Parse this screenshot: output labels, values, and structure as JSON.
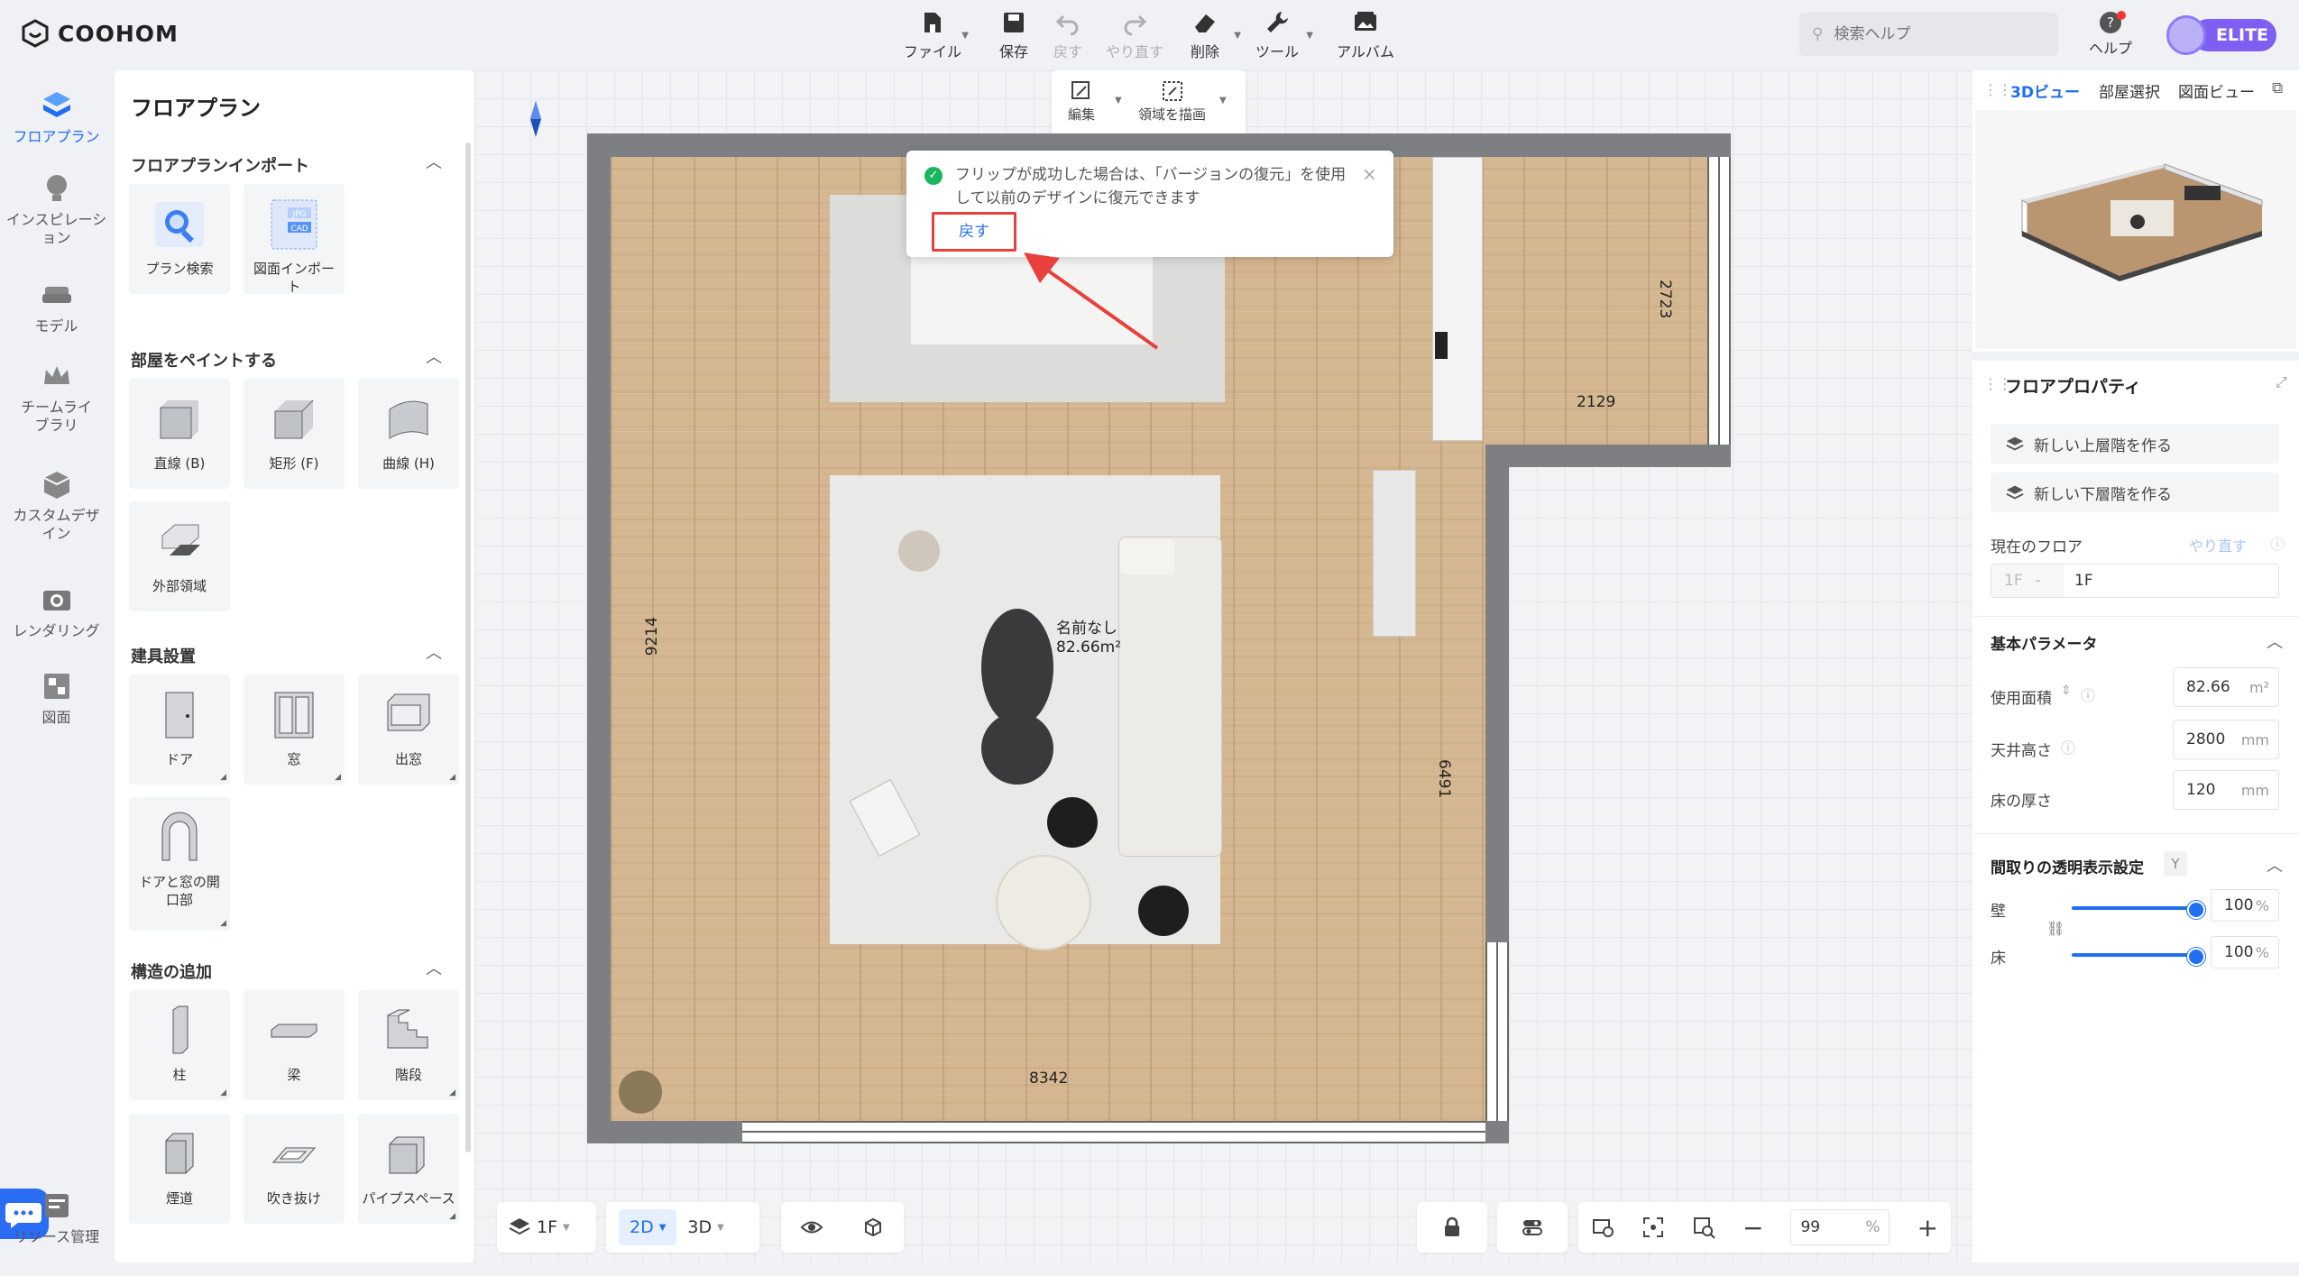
{
  "app": {
    "logo_text": "COOHOM"
  },
  "toolbar": {
    "file": "ファイル",
    "save": "保存",
    "undo": "戻す",
    "redo": "やり直す",
    "delete": "削除",
    "tools": "ツール",
    "album": "アルバム"
  },
  "search": {
    "placeholder": "検索ヘルプ"
  },
  "help": {
    "label": "ヘルプ"
  },
  "account": {
    "badge": "ELITE"
  },
  "leftnav": {
    "items": [
      {
        "label": "フロアプラン",
        "icon": "floorplan-icon"
      },
      {
        "label": "インスピレーション",
        "icon": "lightbulb-icon"
      },
      {
        "label": "モデル",
        "icon": "sofa-icon"
      },
      {
        "label": "チームライブラリ",
        "icon": "crown-icon"
      },
      {
        "label": "カスタムデザイン",
        "icon": "box-icon"
      },
      {
        "label": "レンダリング",
        "icon": "camera-icon"
      },
      {
        "label": "図面",
        "icon": "drawing-icon"
      },
      {
        "label": "リソース管理",
        "icon": "resource-icon"
      }
    ]
  },
  "panel": {
    "title": "フロアプラン",
    "sections": {
      "import": {
        "title": "フロアプランインポート",
        "items": [
          "プラン検索",
          "図面インポート"
        ]
      },
      "paint": {
        "title": "部屋をペイントする",
        "items": [
          "直線 (B)",
          "矩形 (F)",
          "曲線 (H)",
          "外部領域"
        ]
      },
      "fixtures": {
        "title": "建具設置",
        "items": [
          "ドア",
          "窓",
          "出窓",
          "ドアと窓の開口部"
        ]
      },
      "structure": {
        "title": "構造の追加",
        "items": [
          "柱",
          "梁",
          "階段",
          "煙道",
          "吹き抜け",
          "パイプスペース"
        ]
      }
    }
  },
  "edit_toolbar": {
    "edit": "編集",
    "draw_area": "領域を描画"
  },
  "toast": {
    "message": "フリップが成功した場合は、「バージョンの復元」を使用して以前のデザインに復元できます",
    "action": "戻す"
  },
  "plan": {
    "room_name": "名前なし",
    "room_area": "82.66m²",
    "dims": {
      "left": "9214",
      "bottom": "8342",
      "right": "6491",
      "top_right": "2723",
      "notch": "2129"
    }
  },
  "bottom_bar": {
    "floor": "1F",
    "view2d": "2D",
    "view3d": "3D",
    "zoom": "99",
    "zoom_unit": "%"
  },
  "right_panel": {
    "tabs": [
      "3Dビュー",
      "部屋選択",
      "図面ビュー"
    ],
    "props_title": "フロアプロパティ",
    "new_upper": "新しい上層階を作る",
    "new_lower": "新しい下層階を作る",
    "current_floor_label": "現在のフロア",
    "redo": "やり直す",
    "floor_prefix": "1F",
    "floor_value": "1F",
    "basic_params": "基本パラメータ",
    "area_label": "使用面積",
    "area_value": "82.66",
    "area_unit": "m²",
    "ceiling_label": "天井高さ",
    "ceiling_value": "2800",
    "ceiling_unit": "mm",
    "floor_thick_label": "床の厚さ",
    "floor_thick_value": "120",
    "floor_thick_unit": "mm",
    "transparency_title": "間取りの透明表示設定",
    "transparency_key": "Y",
    "wall_label": "壁",
    "wall_value": "100",
    "floor_label": "床",
    "floor_value_pct": "100",
    "pct": "%",
    "wall_opacity": 100,
    "floor_opacity": 100
  },
  "colors": {
    "accent": "#1f6ff0",
    "elite": "#7e5ff2",
    "highlight": "#e8403c",
    "success": "#19b65e"
  }
}
